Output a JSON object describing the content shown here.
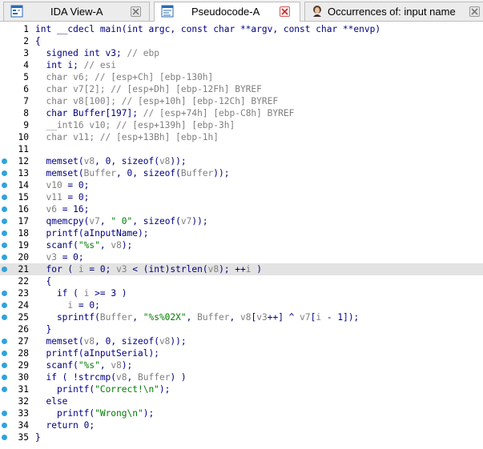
{
  "tabs": [
    {
      "label": "IDA View-A",
      "icon": "ida-view-icon",
      "active": false
    },
    {
      "label": "Pseudocode-A",
      "icon": "pseudocode-icon",
      "active": true
    },
    {
      "label": "Occurrences of: input name",
      "icon": "occurrences-icon",
      "active": false
    }
  ],
  "colors": {
    "keyword": "#000080",
    "comment": "#7f7f7f",
    "variable": "#7f7f7f",
    "string": "#007c00",
    "breakpoint": "#2fa3df",
    "highlight": "#e3e3e3"
  },
  "highlighted_line": 21,
  "lines": [
    {
      "n": "1",
      "bp": false,
      "tokens": [
        [
          "k",
          "int __cdecl main(int argc, const char **argv, const char **envp)"
        ]
      ]
    },
    {
      "n": "2",
      "bp": false,
      "tokens": [
        [
          "k",
          "{"
        ]
      ]
    },
    {
      "n": "3",
      "bp": false,
      "tokens": [
        [
          "k",
          "  signed int v3; "
        ],
        [
          "c",
          "// ebp"
        ]
      ]
    },
    {
      "n": "4",
      "bp": false,
      "tokens": [
        [
          "k",
          "  int i; "
        ],
        [
          "c",
          "// esi"
        ]
      ]
    },
    {
      "n": "5",
      "bp": false,
      "tokens": [
        [
          "c",
          "  char v6; // [esp+Ch] [ebp-130h]"
        ]
      ]
    },
    {
      "n": "6",
      "bp": false,
      "tokens": [
        [
          "c",
          "  char v7[2]; // [esp+Dh] [ebp-12Fh] BYREF"
        ]
      ]
    },
    {
      "n": "7",
      "bp": false,
      "tokens": [
        [
          "c",
          "  char v8[100]; // [esp+10h] [ebp-12Ch] BYREF"
        ]
      ]
    },
    {
      "n": "8",
      "bp": false,
      "tokens": [
        [
          "k",
          "  char Buffer[197]; "
        ],
        [
          "c",
          "// [esp+74h] [ebp-C8h] BYREF"
        ]
      ]
    },
    {
      "n": "9",
      "bp": false,
      "tokens": [
        [
          "c",
          "  __int16 v10; // [esp+139h] [ebp-3h]"
        ]
      ]
    },
    {
      "n": "10",
      "bp": false,
      "tokens": [
        [
          "c",
          "  char v11; // [esp+13Bh] [ebp-1h]"
        ]
      ]
    },
    {
      "n": "11",
      "bp": false,
      "tokens": []
    },
    {
      "n": "12",
      "bp": true,
      "tokens": [
        [
          "k",
          "  memset("
        ],
        [
          "v",
          "v8"
        ],
        [
          "k",
          ", 0, sizeof("
        ],
        [
          "v",
          "v8"
        ],
        [
          "k",
          "));"
        ]
      ]
    },
    {
      "n": "13",
      "bp": true,
      "tokens": [
        [
          "k",
          "  memset("
        ],
        [
          "v",
          "Buffer"
        ],
        [
          "k",
          ", 0, sizeof("
        ],
        [
          "v",
          "Buffer"
        ],
        [
          "k",
          "));"
        ]
      ]
    },
    {
      "n": "14",
      "bp": true,
      "tokens": [
        [
          "v",
          "  v10"
        ],
        [
          "k",
          " = 0;"
        ]
      ]
    },
    {
      "n": "15",
      "bp": true,
      "tokens": [
        [
          "v",
          "  v11"
        ],
        [
          "k",
          " = 0;"
        ]
      ]
    },
    {
      "n": "16",
      "bp": true,
      "tokens": [
        [
          "v",
          "  v6"
        ],
        [
          "k",
          " = 16;"
        ]
      ]
    },
    {
      "n": "17",
      "bp": true,
      "tokens": [
        [
          "k",
          "  qmemcpy("
        ],
        [
          "v",
          "v7"
        ],
        [
          "k",
          ", "
        ],
        [
          "s",
          "\" 0\""
        ],
        [
          "k",
          ", sizeof("
        ],
        [
          "v",
          "v7"
        ],
        [
          "k",
          "));"
        ]
      ]
    },
    {
      "n": "18",
      "bp": true,
      "tokens": [
        [
          "k",
          "  printf(aInputName);"
        ]
      ]
    },
    {
      "n": "19",
      "bp": true,
      "tokens": [
        [
          "k",
          "  scanf("
        ],
        [
          "s",
          "\"%s\""
        ],
        [
          "k",
          ", "
        ],
        [
          "v",
          "v8"
        ],
        [
          "k",
          ");"
        ]
      ]
    },
    {
      "n": "20",
      "bp": true,
      "tokens": [
        [
          "v",
          "  v3"
        ],
        [
          "k",
          " = 0;"
        ]
      ]
    },
    {
      "n": "21",
      "bp": true,
      "tokens": [
        [
          "k",
          "  for ( "
        ],
        [
          "v",
          "i"
        ],
        [
          "k",
          " = 0; "
        ],
        [
          "v",
          "v3"
        ],
        [
          "k",
          " < (int)strlen("
        ],
        [
          "v",
          "v8"
        ],
        [
          "k",
          "); ++"
        ],
        [
          "v",
          "i"
        ],
        [
          "k",
          " )"
        ]
      ]
    },
    {
      "n": "22",
      "bp": false,
      "tokens": [
        [
          "k",
          "  {"
        ]
      ]
    },
    {
      "n": "23",
      "bp": true,
      "tokens": [
        [
          "k",
          "    if ( "
        ],
        [
          "v",
          "i"
        ],
        [
          "k",
          " >= 3 )"
        ]
      ]
    },
    {
      "n": "24",
      "bp": true,
      "tokens": [
        [
          "v",
          "      i"
        ],
        [
          "k",
          " = 0;"
        ]
      ]
    },
    {
      "n": "25",
      "bp": true,
      "tokens": [
        [
          "k",
          "    sprintf("
        ],
        [
          "v",
          "Buffer"
        ],
        [
          "k",
          ", "
        ],
        [
          "s",
          "\"%s%02X\""
        ],
        [
          "k",
          ", "
        ],
        [
          "v",
          "Buffer"
        ],
        [
          "k",
          ", "
        ],
        [
          "v",
          "v8"
        ],
        [
          "k",
          "["
        ],
        [
          "v",
          "v3"
        ],
        [
          "k",
          "++] ^ "
        ],
        [
          "v",
          "v7"
        ],
        [
          "k",
          "["
        ],
        [
          "v",
          "i"
        ],
        [
          "k",
          " - 1]);"
        ]
      ]
    },
    {
      "n": "26",
      "bp": false,
      "tokens": [
        [
          "k",
          "  }"
        ]
      ]
    },
    {
      "n": "27",
      "bp": true,
      "tokens": [
        [
          "k",
          "  memset("
        ],
        [
          "v",
          "v8"
        ],
        [
          "k",
          ", 0, sizeof("
        ],
        [
          "v",
          "v8"
        ],
        [
          "k",
          "));"
        ]
      ]
    },
    {
      "n": "28",
      "bp": true,
      "tokens": [
        [
          "k",
          "  printf(aInputSerial);"
        ]
      ]
    },
    {
      "n": "29",
      "bp": true,
      "tokens": [
        [
          "k",
          "  scanf("
        ],
        [
          "s",
          "\"%s\""
        ],
        [
          "k",
          ", "
        ],
        [
          "v",
          "v8"
        ],
        [
          "k",
          ");"
        ]
      ]
    },
    {
      "n": "30",
      "bp": true,
      "tokens": [
        [
          "k",
          "  if ( !strcmp("
        ],
        [
          "v",
          "v8"
        ],
        [
          "k",
          ", "
        ],
        [
          "v",
          "Buffer"
        ],
        [
          "k",
          ") )"
        ]
      ]
    },
    {
      "n": "31",
      "bp": true,
      "tokens": [
        [
          "k",
          "    printf("
        ],
        [
          "s",
          "\"Correct!\\n\""
        ],
        [
          "k",
          ");"
        ]
      ]
    },
    {
      "n": "32",
      "bp": false,
      "tokens": [
        [
          "k",
          "  else"
        ]
      ]
    },
    {
      "n": "33",
      "bp": true,
      "tokens": [
        [
          "k",
          "    printf("
        ],
        [
          "s",
          "\"Wrong\\n\""
        ],
        [
          "k",
          ");"
        ]
      ]
    },
    {
      "n": "34",
      "bp": true,
      "tokens": [
        [
          "k",
          "  return 0;"
        ]
      ]
    },
    {
      "n": "35",
      "bp": true,
      "tokens": [
        [
          "k",
          "}"
        ]
      ]
    }
  ]
}
